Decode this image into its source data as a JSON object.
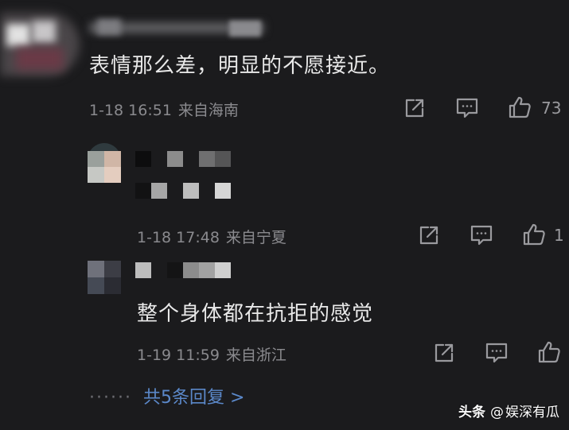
{
  "comments": [
    {
      "text": "表情那么差，明显的不愿接近。",
      "time": "1-18 16:51",
      "location": "来自海南",
      "like_count": "73"
    }
  ],
  "replies": [
    {
      "text": "",
      "time": "1-18 17:48",
      "location": "来自宁夏",
      "like_count": "1"
    },
    {
      "text": "整个身体都在抗拒的感觉",
      "time": "1-19 11:59",
      "location": "来自浙江",
      "like_count": ""
    }
  ],
  "more_replies": {
    "dots": "······",
    "label": "共5条回复 >"
  },
  "watermark": {
    "brand": "头条",
    "separator": "@",
    "account": "娱深有瓜"
  },
  "icons": {
    "share": "share-icon",
    "comment": "comment-icon",
    "like": "thumbs-up-icon"
  },
  "colors": {
    "background": "#1b1b1d",
    "text": "#e9e9e9",
    "meta": "#8a8a8e",
    "link": "#5b88c9"
  }
}
